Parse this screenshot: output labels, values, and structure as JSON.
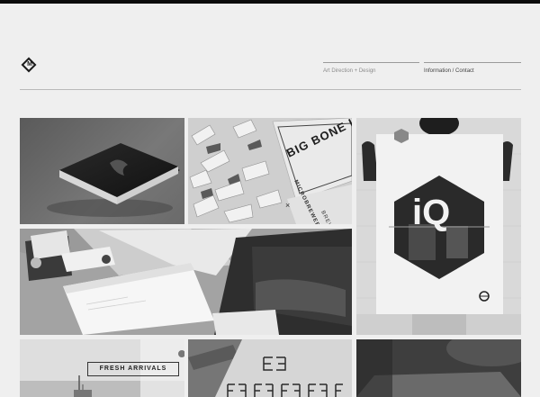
{
  "header": {
    "logo_mark": "M",
    "nav": [
      {
        "label": "Art Direction + Design"
      },
      {
        "label": "Information / Contact"
      }
    ]
  },
  "portfolio": {
    "tiles": [
      {
        "subject": "dark printed book mockup"
      },
      {
        "subject": "shredded paper packaging with labels"
      },
      {
        "subject": "person holding hexagon poster"
      },
      {
        "subject": "stationery and business cards"
      },
      {
        "subject": "harbor with fresh arrivals sign"
      },
      {
        "subject": "repeated monogram pattern"
      },
      {
        "subject": "dark interior detail"
      }
    ],
    "big_bone_text": "BIG BONE L",
    "microbrewery_text": "MICROBREWERY",
    "brewed_text": "BREWED",
    "fresh_arrivals_label": "FRESH ARRIVALS",
    "poster_text": "iQ"
  }
}
